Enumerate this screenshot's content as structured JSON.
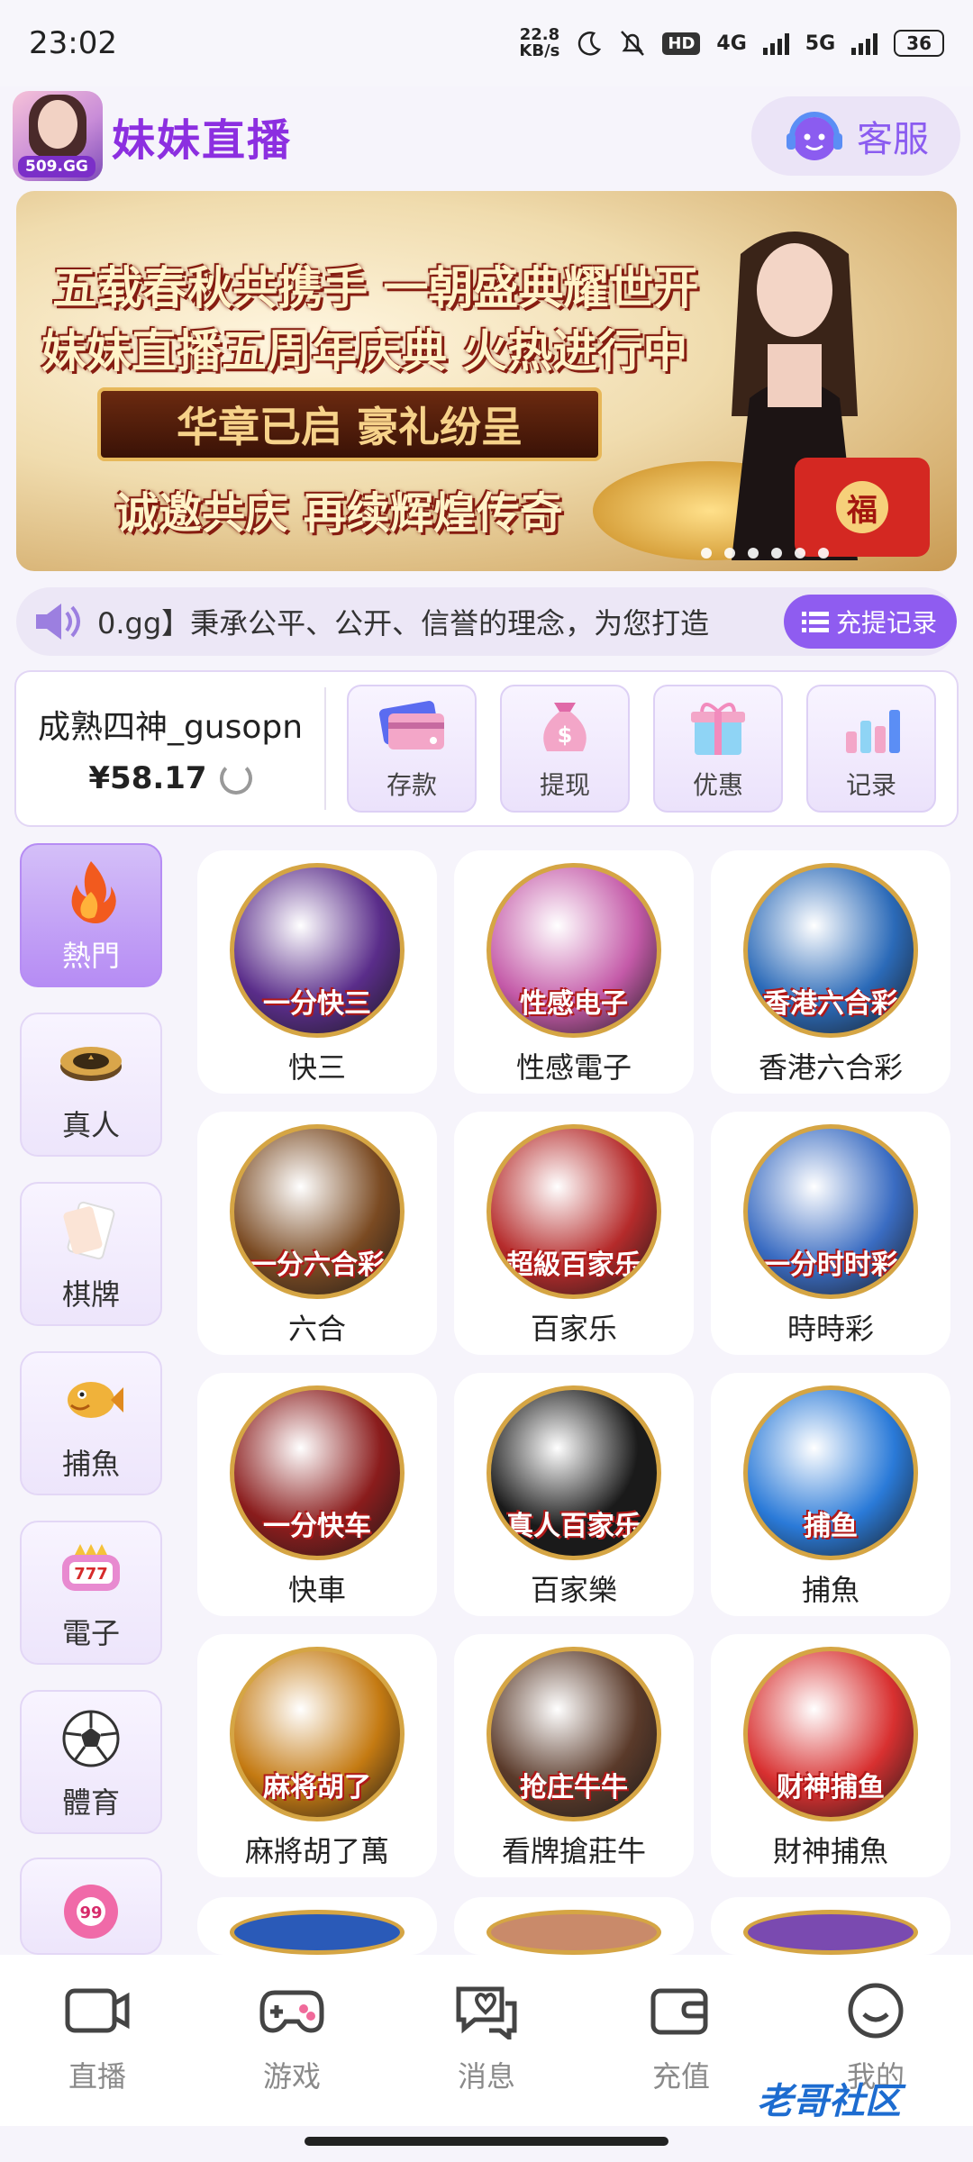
{
  "status_bar": {
    "time": "23:02",
    "speed_value": "22.8",
    "speed_unit": "KB/s",
    "hd": "HD",
    "net1": "4G",
    "net2": "5G",
    "battery": "36"
  },
  "header": {
    "logo_tag": "509.GG",
    "brand": "妹妹直播",
    "service_label": "客服"
  },
  "banner": {
    "line1": "五载春秋共携手 一朝盛典耀世开",
    "line2": "妹妹直播五周年庆典 火热进行中",
    "line3": "华章已启 豪礼纷呈",
    "line4": "诚邀共庆 再续辉煌传奇",
    "gift_text": "福"
  },
  "marquee": {
    "text": "0.gg】秉承公平、公开、信誉的理念，为您打造",
    "record_button": "充提记录"
  },
  "user": {
    "name": "成熟四神_gusopn",
    "balance": "¥58.17"
  },
  "actions": [
    {
      "label": "存款",
      "icon": "card-icon"
    },
    {
      "label": "提现",
      "icon": "money-bag-icon"
    },
    {
      "label": "优惠",
      "icon": "gift-icon"
    },
    {
      "label": "记录",
      "icon": "bar-chart-icon"
    }
  ],
  "categories": [
    {
      "label": "熱門",
      "icon": "flame-icon",
      "active": true
    },
    {
      "label": "真人",
      "icon": "casino-chip-icon"
    },
    {
      "label": "棋牌",
      "icon": "playing-card-icon"
    },
    {
      "label": "捕魚",
      "icon": "fish-icon"
    },
    {
      "label": "電子",
      "icon": "slot-machine-icon"
    },
    {
      "label": "體育",
      "icon": "soccer-ball-icon"
    },
    {
      "label": "",
      "icon": "lottery-ball-icon"
    }
  ],
  "games": [
    {
      "name": "快三",
      "caption": "一分快三",
      "color": "#5a2d8a"
    },
    {
      "name": "性感電子",
      "caption": "性感电子",
      "color": "#c45aa8"
    },
    {
      "name": "香港六合彩",
      "caption": "香港六合彩",
      "color": "#2b6ab8"
    },
    {
      "name": "六合",
      "caption": "一分六合彩",
      "color": "#7a4a22"
    },
    {
      "name": "百家乐",
      "caption": "超級百家乐",
      "color": "#b52b2b"
    },
    {
      "name": "時時彩",
      "caption": "一分时时彩",
      "color": "#3a6cc2"
    },
    {
      "name": "快車",
      "caption": "一分快车",
      "color": "#8a1c1c"
    },
    {
      "name": "百家樂",
      "caption": "真人百家乐",
      "color": "#1a1a1a"
    },
    {
      "name": "捕魚",
      "caption": "捕鱼",
      "color": "#2a7ad8"
    },
    {
      "name": "麻將胡了萬",
      "caption": "麻将胡了",
      "color": "#c47a12"
    },
    {
      "name": "看牌搶莊牛",
      "caption": "抢庄牛牛",
      "color": "#5a3a2a"
    },
    {
      "name": "財神捕魚",
      "caption": "财神捕鱼",
      "color": "#d83030"
    }
  ],
  "bottom_nav": [
    {
      "label": "直播",
      "icon": "video-icon"
    },
    {
      "label": "游戏",
      "icon": "gamepad-icon"
    },
    {
      "label": "消息",
      "icon": "chat-icon"
    },
    {
      "label": "充值",
      "icon": "wallet-icon"
    },
    {
      "label": "我的",
      "icon": "smile-icon"
    }
  ],
  "watermark": "老哥社区"
}
